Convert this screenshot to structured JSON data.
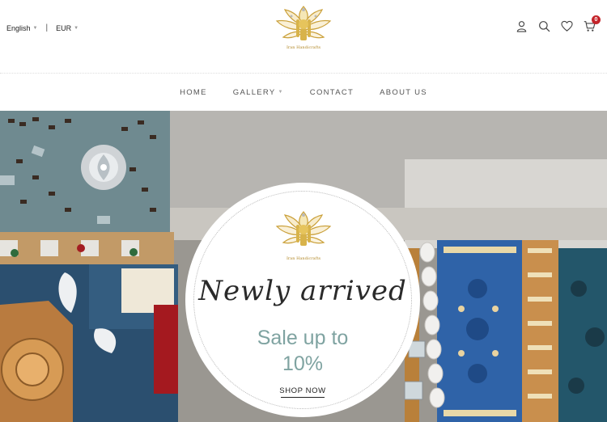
{
  "header": {
    "language": "English",
    "currency": "EUR",
    "logo_text": "Iran Handicrafts",
    "icons": [
      "user-icon",
      "search-icon",
      "heart-icon",
      "cart-icon"
    ],
    "cart_count": "0"
  },
  "nav": {
    "items": [
      {
        "label": "HOME",
        "has_dropdown": false
      },
      {
        "label": "GALLERY",
        "has_dropdown": true
      },
      {
        "label": "CONTACT",
        "has_dropdown": false
      },
      {
        "label": "ABOUT US",
        "has_dropdown": false
      }
    ]
  },
  "hero": {
    "logo_text": "Iran Handicrafts",
    "headline": "Newly arrived",
    "sale_line1": "Sale up to",
    "sale_line2": "10%",
    "cta": "SHOP NOW"
  },
  "colors": {
    "accent_teal": "#7fa3a1",
    "badge_red": "#c4242a",
    "logo_gold": "#b38a2a"
  }
}
